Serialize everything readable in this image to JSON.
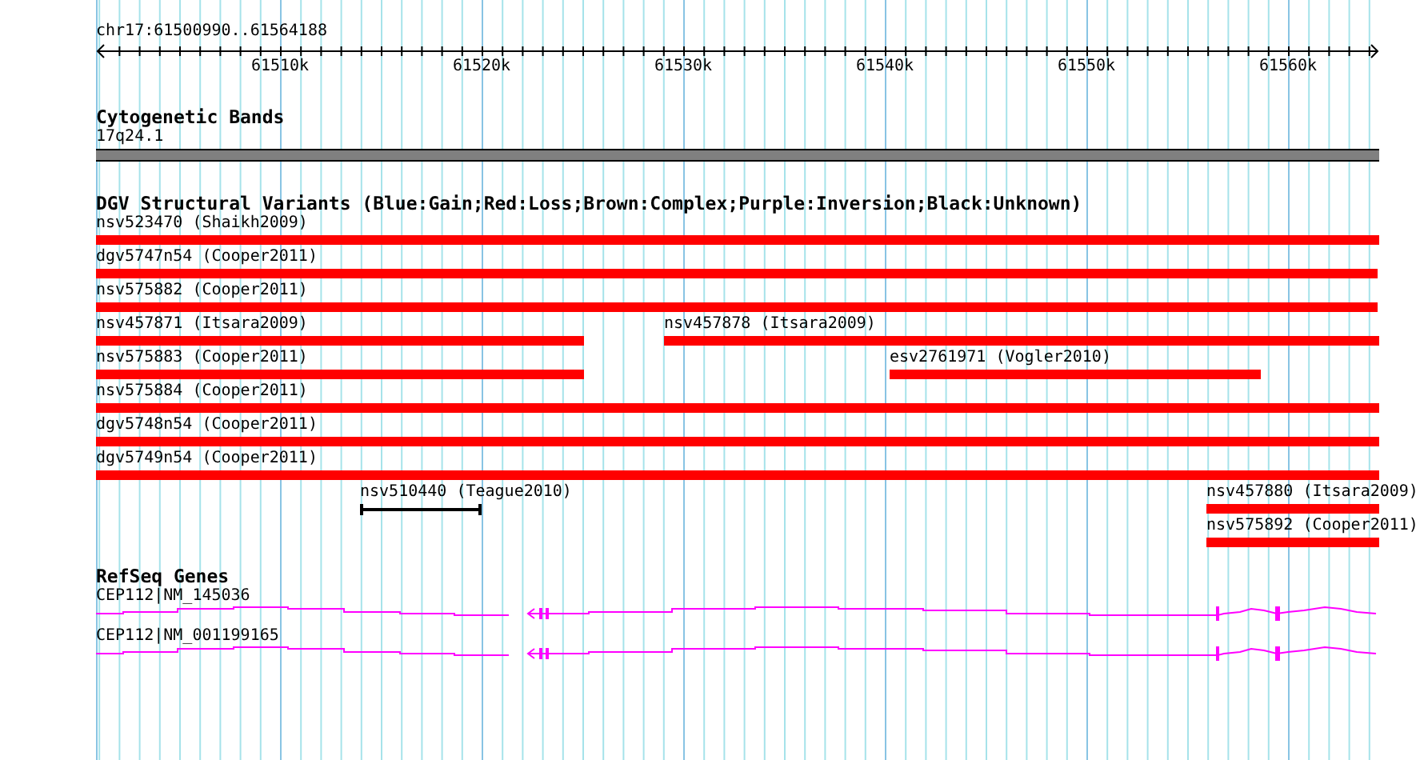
{
  "ruler": {
    "region": "chr17:61500990..61564188",
    "ticks": [
      "61510k",
      "61520k",
      "61530k",
      "61540k",
      "61550k",
      "61560k"
    ]
  },
  "tracks": [
    {
      "kind": "band",
      "title": "Cytogenetic Bands",
      "feature": {
        "label": "17q24.1"
      }
    },
    {
      "kind": "variants",
      "title": "DGV Structural Variants (Blue:Gain;Red:Loss;Brown:Complex;Purple:Inversion;Black:Unknown)",
      "rows": [
        [
          {
            "label": "nsv523470 (Shaikh2009)",
            "kind": "bar",
            "color": "#ff0000"
          }
        ],
        [
          {
            "label": "dgv5747n54 (Cooper2011)",
            "kind": "bar",
            "color": "#ff0000"
          }
        ],
        [
          {
            "label": "nsv575882 (Cooper2011)",
            "kind": "bar",
            "color": "#ff0000"
          }
        ],
        [
          {
            "label": "nsv457871 (Itsara2009)",
            "kind": "bar",
            "color": "#ff0000"
          },
          {
            "label": "nsv457878 (Itsara2009)",
            "kind": "bar",
            "color": "#ff0000"
          }
        ],
        [
          {
            "label": "nsv575883 (Cooper2011)",
            "kind": "bar",
            "color": "#ff0000"
          },
          {
            "label": "esv2761971 (Vogler2010)",
            "kind": "bar",
            "color": "#ff0000"
          }
        ],
        [
          {
            "label": "nsv575884 (Cooper2011)",
            "kind": "bar",
            "color": "#ff0000"
          }
        ],
        [
          {
            "label": "dgv5748n54 (Cooper2011)",
            "kind": "bar",
            "color": "#ff0000"
          }
        ],
        [
          {
            "label": "dgv5749n54 (Cooper2011)",
            "kind": "bar",
            "color": "#ff0000"
          }
        ],
        [
          {
            "label": "nsv510440 (Teague2010)",
            "kind": "span",
            "color": "#000000"
          },
          {
            "label": "nsv457880 (Itsara2009)",
            "kind": "bar",
            "color": "#ff0000"
          }
        ],
        [
          {
            "label": "nsv575892 (Cooper2011)",
            "kind": "bar",
            "color": "#ff0000"
          }
        ]
      ]
    },
    {
      "kind": "genes",
      "title": "RefSeq Genes",
      "genes": [
        {
          "label": "CEP112|NM_145036"
        },
        {
          "label": "CEP112|NM_001199165"
        }
      ]
    }
  ]
}
